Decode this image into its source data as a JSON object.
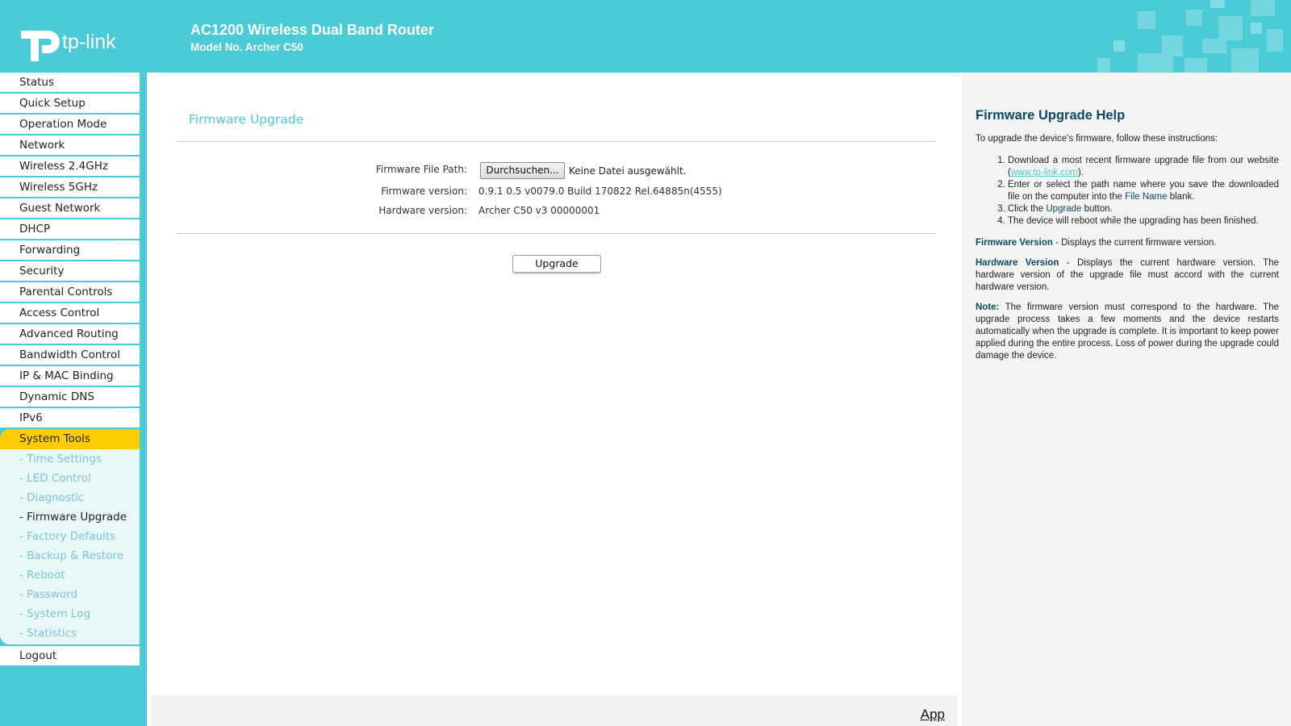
{
  "header": {
    "logo_text": "tp-link",
    "title": "AC1200 Wireless Dual Band Router",
    "model": "Model No. Archer C50"
  },
  "sidebar": {
    "items": [
      {
        "label": "Status"
      },
      {
        "label": "Quick Setup"
      },
      {
        "label": "Operation Mode"
      },
      {
        "label": "Network"
      },
      {
        "label": "Wireless 2.4GHz"
      },
      {
        "label": "Wireless 5GHz"
      },
      {
        "label": "Guest Network"
      },
      {
        "label": "DHCP"
      },
      {
        "label": "Forwarding"
      },
      {
        "label": "Security"
      },
      {
        "label": "Parental Controls"
      },
      {
        "label": "Access Control"
      },
      {
        "label": "Advanced Routing"
      },
      {
        "label": "Bandwidth Control"
      },
      {
        "label": "IP & MAC Binding"
      },
      {
        "label": "Dynamic DNS"
      },
      {
        "label": "IPv6"
      }
    ],
    "active_item": "System Tools",
    "sub_items": [
      {
        "label": "- Time Settings"
      },
      {
        "label": "- LED Control"
      },
      {
        "label": "- Diagnostic"
      },
      {
        "label": "- Firmware Upgrade"
      },
      {
        "label": "- Factory Defaults"
      },
      {
        "label": "- Backup & Restore"
      },
      {
        "label": "- Reboot"
      },
      {
        "label": "- Password"
      },
      {
        "label": "- System Log"
      },
      {
        "label": "- Statistics"
      }
    ],
    "logout": "Logout"
  },
  "main": {
    "section_title": "Firmware Upgrade",
    "file_path_label": "Firmware File Path:",
    "browse_button": "Durchsuchen...",
    "file_status": "Keine Datei ausgewählt.",
    "firmware_version_label": "Firmware version:",
    "firmware_version_value": "0.9.1 0.5 v0079.0 Build 170822 Rel.64885n(4555)",
    "hardware_version_label": "Hardware version:",
    "hardware_version_value": "Archer C50 v3 00000001",
    "upgrade_button": "Upgrade",
    "footer_link": "App"
  },
  "help": {
    "title": "Firmware Upgrade Help",
    "intro": "To upgrade the device's firmware, follow these instructions:",
    "step1_text": "Download a most recent firmware upgrade file from our website",
    "step1_link": "www.tp-link.com",
    "step2_pre": "Enter or select the path name where you save the downloaded file on the computer into the",
    "step2_kw": "File Name",
    "step2_post": "blank.",
    "step3_pre": "Click the",
    "step3_kw": "Upgrade",
    "step3_post": "button.",
    "step4": "The device will reboot while the upgrading has been finished.",
    "fw_kw": "Firmware Version",
    "fw_text": "- Displays the current firmware version.",
    "hw_kw": "Hardware Version",
    "hw_text": "- Displays the current hardware version. The hardware version of the upgrade file must accord with the current hardware version.",
    "note_kw": "Note:",
    "note_text": "The firmware version must correspond to the hardware. The upgrade process takes a few moments and the device restarts automatically when the upgrade is complete. It is important to keep power applied during the entire process. Loss of power during the upgrade could damage the device."
  },
  "colors": {
    "brand": "#4acbd6",
    "active": "#fecd01",
    "help_keyword": "#0b4a63"
  }
}
